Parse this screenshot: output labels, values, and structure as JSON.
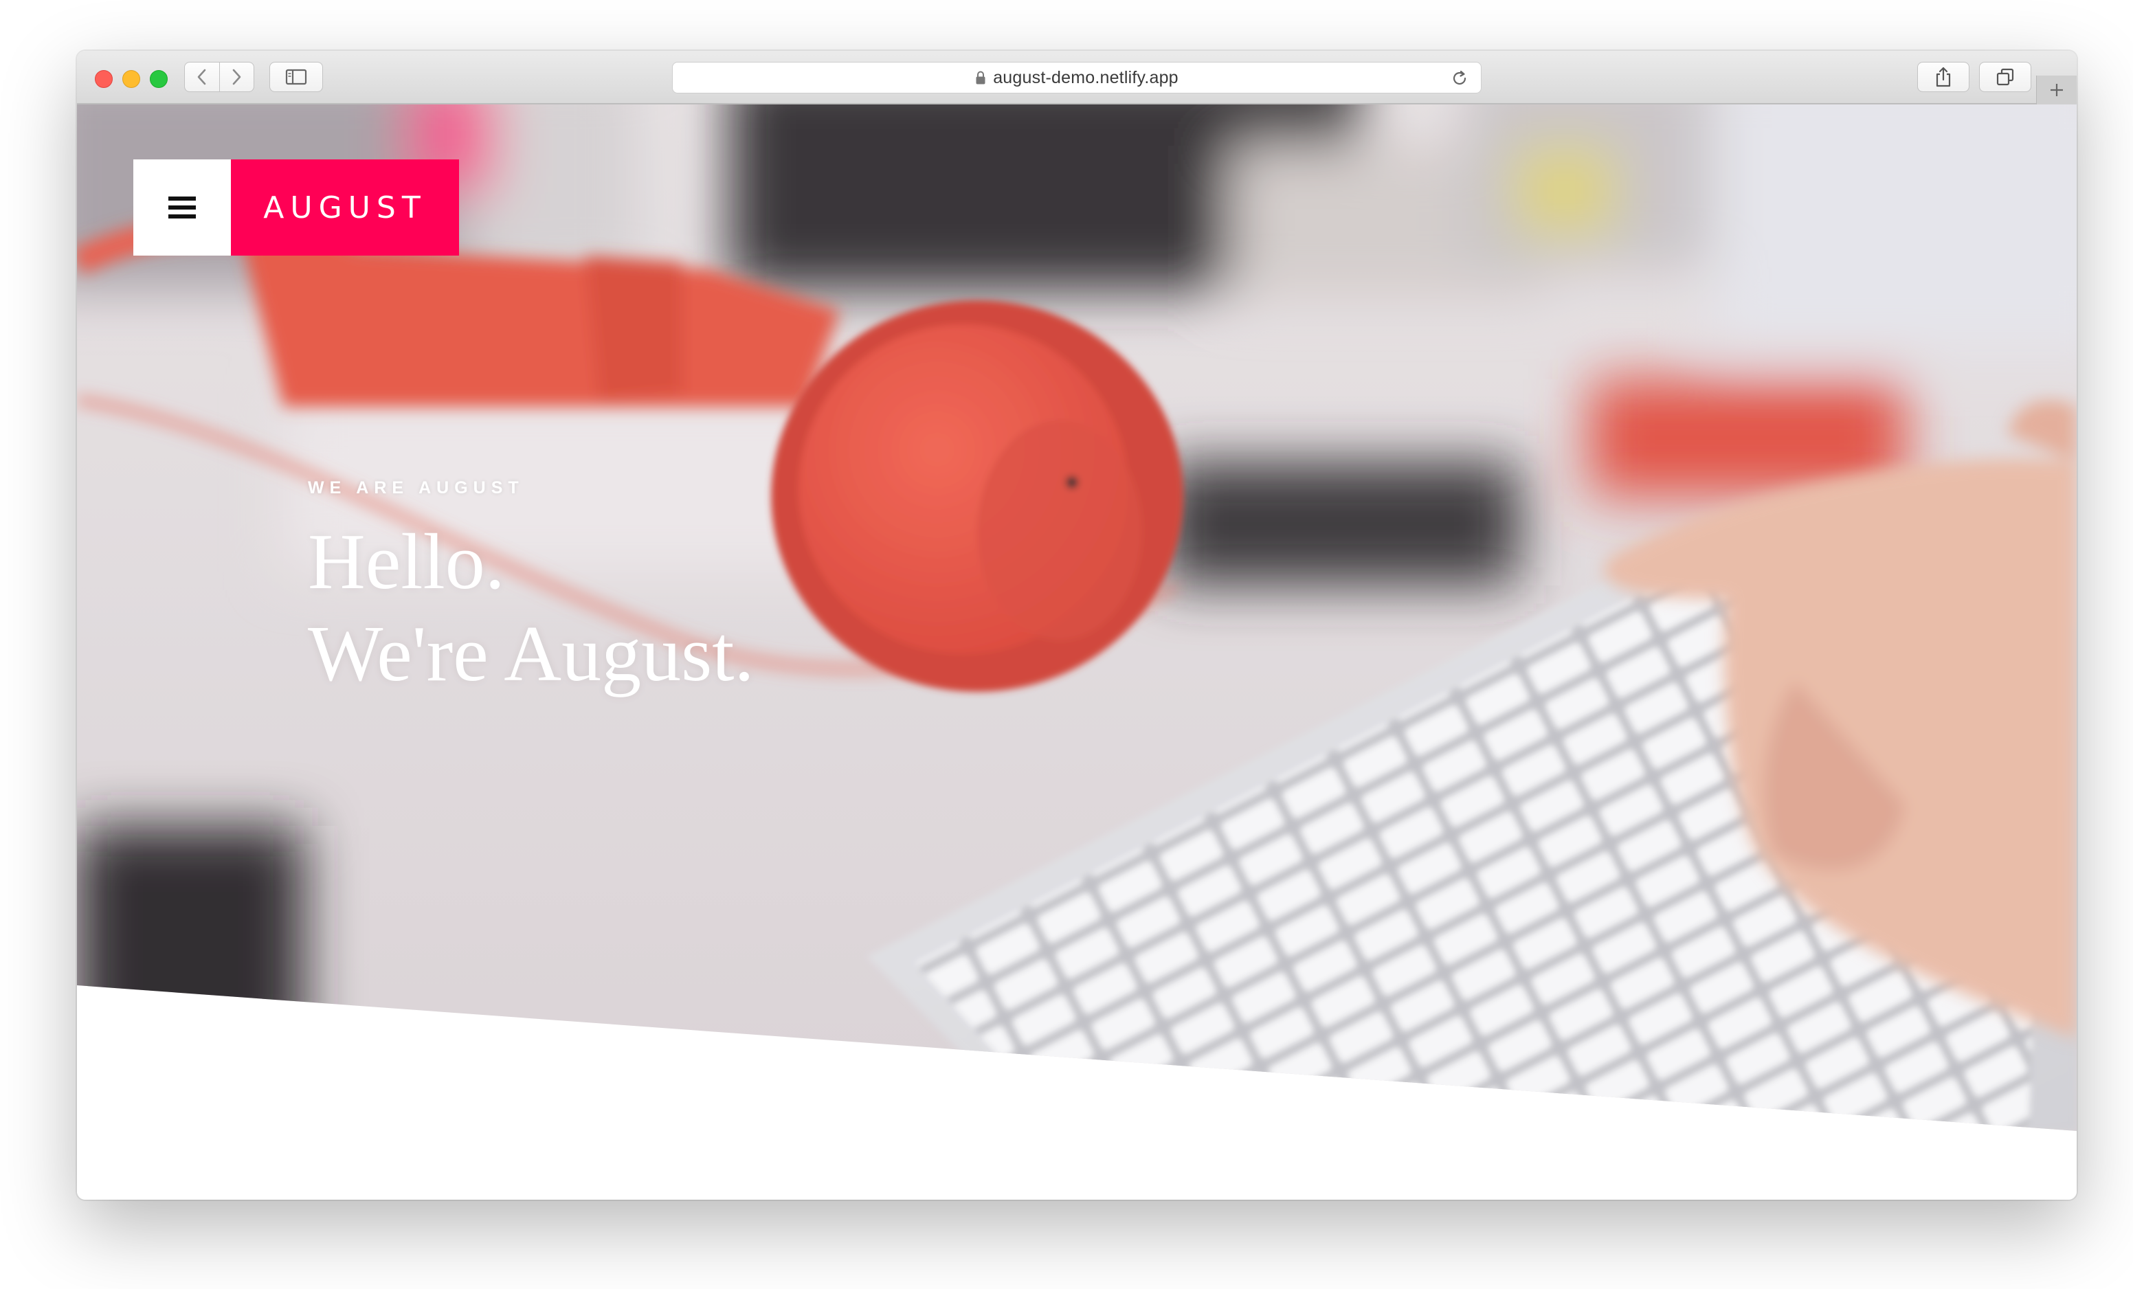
{
  "browser": {
    "url": "august-demo.netlify.app"
  },
  "site": {
    "brand": "AUGUST",
    "accent_color": "#ff0055"
  },
  "hero": {
    "eyebrow": "WE ARE AUGUST",
    "headline_line1": "Hello.",
    "headline_line2": "We're August."
  },
  "icons": {
    "menu": "hamburger-icon",
    "lock": "lock-icon",
    "reload": "reload-icon",
    "back": "chevron-left-icon",
    "forward": "chevron-right-icon",
    "sidebar": "sidebar-icon",
    "share": "share-icon",
    "tabs": "tabs-overview-icon",
    "new_tab": "plus-icon"
  }
}
